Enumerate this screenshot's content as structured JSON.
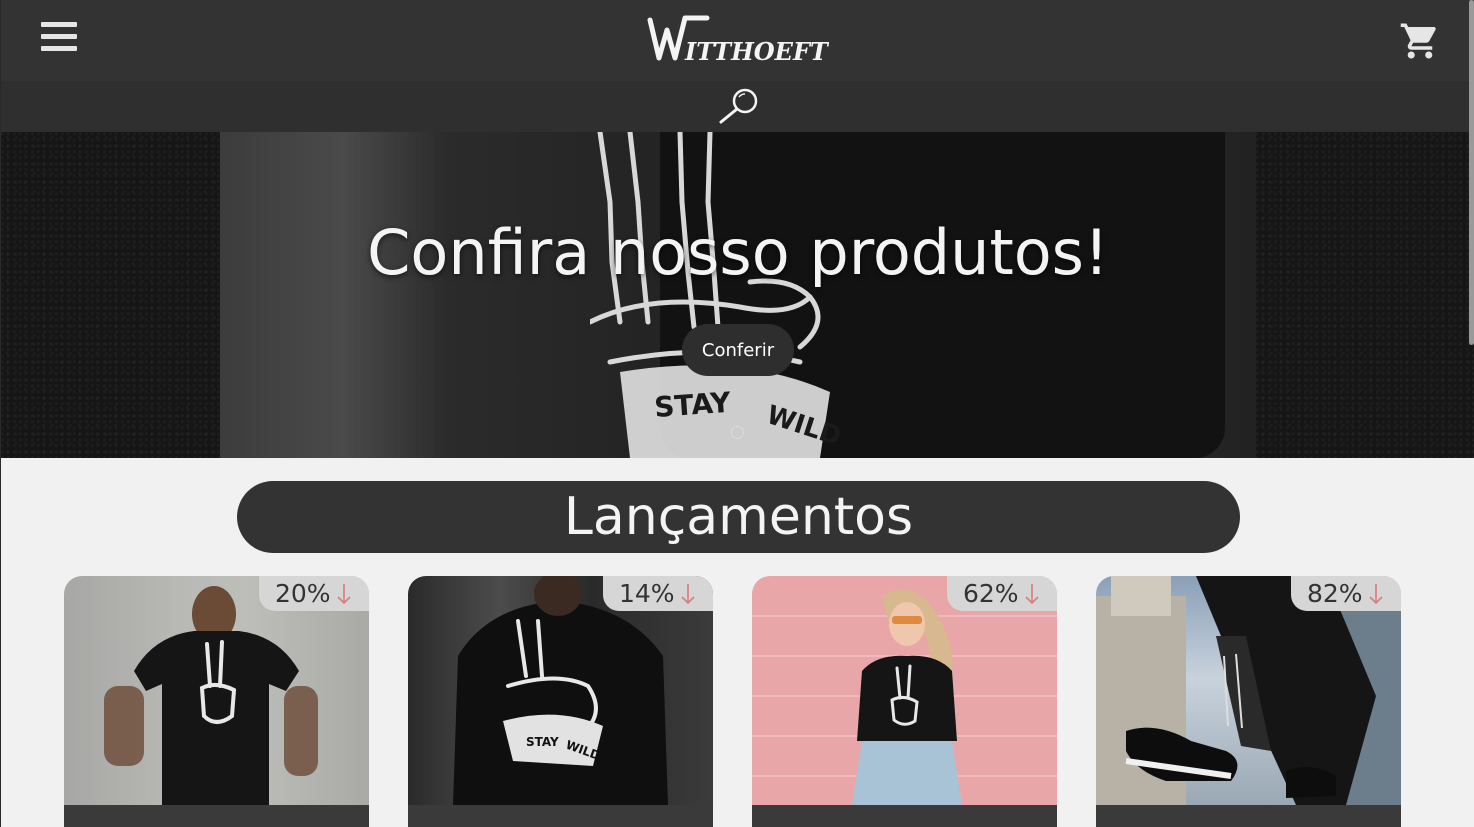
{
  "header": {
    "menu_icon": "hamburger-menu-icon",
    "logo_text_first": "W",
    "logo_text_rest": "ITTHOEFT",
    "cart_icon": "shopping-cart-icon"
  },
  "search": {
    "icon": "magnifying-glass-icon"
  },
  "hero": {
    "title": "Confira nosso produtos!",
    "button_label": "Conferir",
    "slide_count": 1
  },
  "section": {
    "title": "Lançamentos"
  },
  "products": [
    {
      "discount": "20%",
      "arrow_icon": "arrow-down-icon"
    },
    {
      "discount": "14%",
      "arrow_icon": "arrow-down-icon"
    },
    {
      "discount": "62%",
      "arrow_icon": "arrow-down-icon"
    },
    {
      "discount": "82%",
      "arrow_icon": "arrow-down-icon"
    }
  ],
  "colors": {
    "header_bg": "#333333",
    "search_bg": "#2f2f2f",
    "page_bg": "#f1f1f1",
    "discount_bg": "#d6d6d6",
    "discount_arrow": "#d97a7a"
  }
}
